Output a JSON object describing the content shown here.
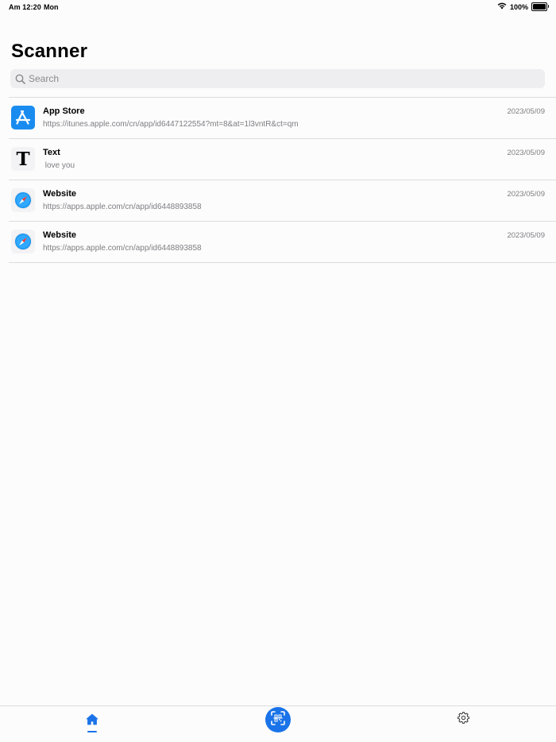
{
  "status_bar": {
    "time": "Am 12:20",
    "day": "Mon",
    "battery": "100%"
  },
  "page_title": "Scanner",
  "search": {
    "placeholder": "Search",
    "value": ""
  },
  "items": [
    {
      "type": "app-store",
      "icon": "app-store-icon",
      "title": "App Store",
      "subtitle": "https://itunes.apple.com/cn/app/id6447122554?mt=8&at=1l3vntR&ct=qm",
      "date": "2023/05/09"
    },
    {
      "type": "text",
      "icon": "text-icon",
      "icon_glyph": "T",
      "title": "Text",
      "subtitle": " love you",
      "date": "2023/05/09"
    },
    {
      "type": "website",
      "icon": "safari-icon",
      "title": "Website",
      "subtitle": "https://apps.apple.com/cn/app/id6448893858",
      "date": "2023/05/09"
    },
    {
      "type": "website",
      "icon": "safari-icon",
      "title": "Website",
      "subtitle": "https://apps.apple.com/cn/app/id6448893858",
      "date": "2023/05/09"
    }
  ],
  "tab_bar": {
    "tabs": [
      {
        "name": "home",
        "icon": "home-icon",
        "selected": true
      },
      {
        "name": "scan",
        "icon": "qr-scan-icon",
        "selected": false
      },
      {
        "name": "settings",
        "icon": "gear-icon",
        "selected": false
      }
    ]
  },
  "colors": {
    "accent": "#1a73e8",
    "app_store_blue": "#1a8cf0",
    "secondary_text": "#7e7e83",
    "search_bg": "#eeeef0"
  }
}
